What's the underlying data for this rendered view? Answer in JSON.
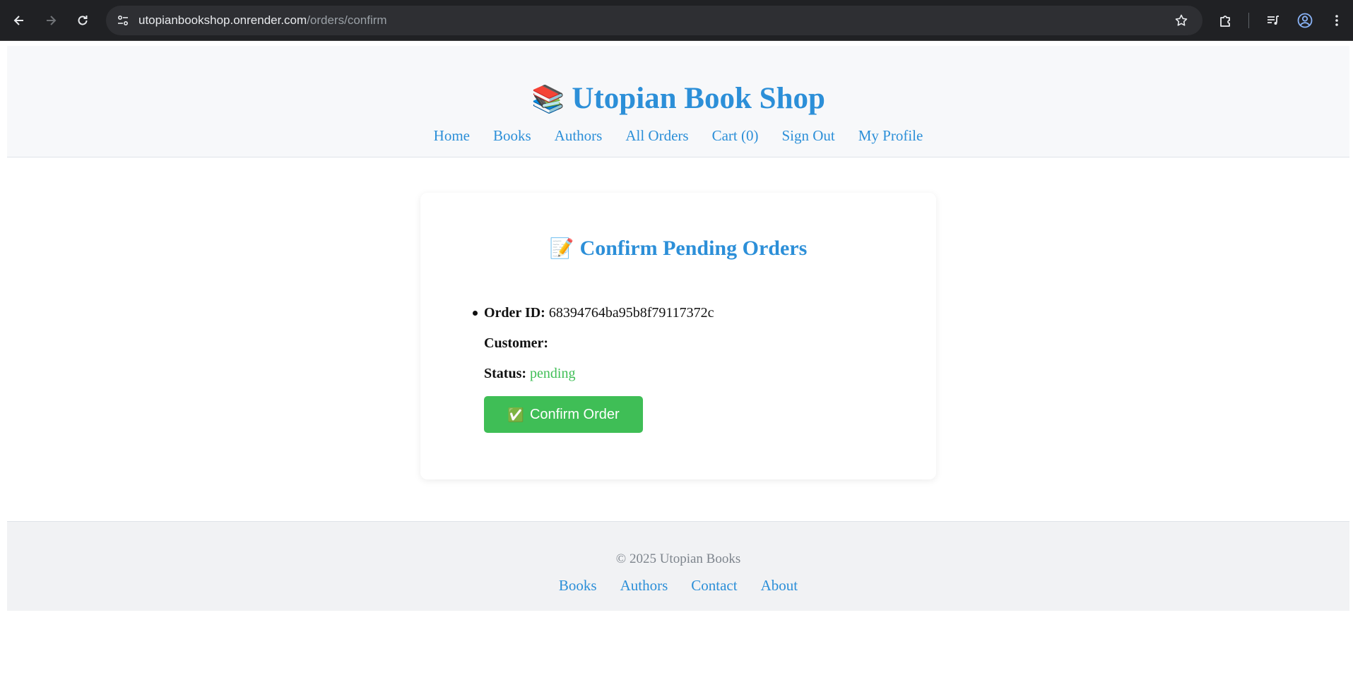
{
  "browser": {
    "url_domain": "utopianbookshop.onrender.com",
    "url_path": "/orders/confirm",
    "icons": {
      "back": "arrow-left-icon",
      "forward": "arrow-right-icon",
      "reload": "reload-icon",
      "site_info": "tune-icon",
      "bookmark": "star-icon",
      "extensions": "puzzle-icon",
      "media": "media-controls-icon",
      "profile": "account-circle-icon",
      "menu": "kebab-menu-icon"
    }
  },
  "header": {
    "emoji": "📚",
    "title": "Utopian Book Shop",
    "nav": [
      "Home",
      "Books",
      "Authors",
      "All Orders",
      "Cart (0)",
      "Sign Out",
      "My Profile"
    ]
  },
  "main": {
    "heading_emoji": "📝",
    "heading": "Confirm Pending Orders",
    "orders": [
      {
        "order_id_label": "Order ID:",
        "order_id": "68394764ba95b8f79117372c",
        "customer_label": "Customer:",
        "customer": "",
        "status_label": "Status:",
        "status": "pending",
        "confirm_icon": "✅",
        "confirm_label": "Confirm Order"
      }
    ]
  },
  "footer": {
    "copyright": "© 2025 Utopian Books",
    "links": [
      "Books",
      "Authors",
      "Contact",
      "About"
    ]
  },
  "colors": {
    "brand_blue": "#2c8fd8",
    "success_green": "#3fbe56",
    "chrome_bg": "#202124"
  }
}
